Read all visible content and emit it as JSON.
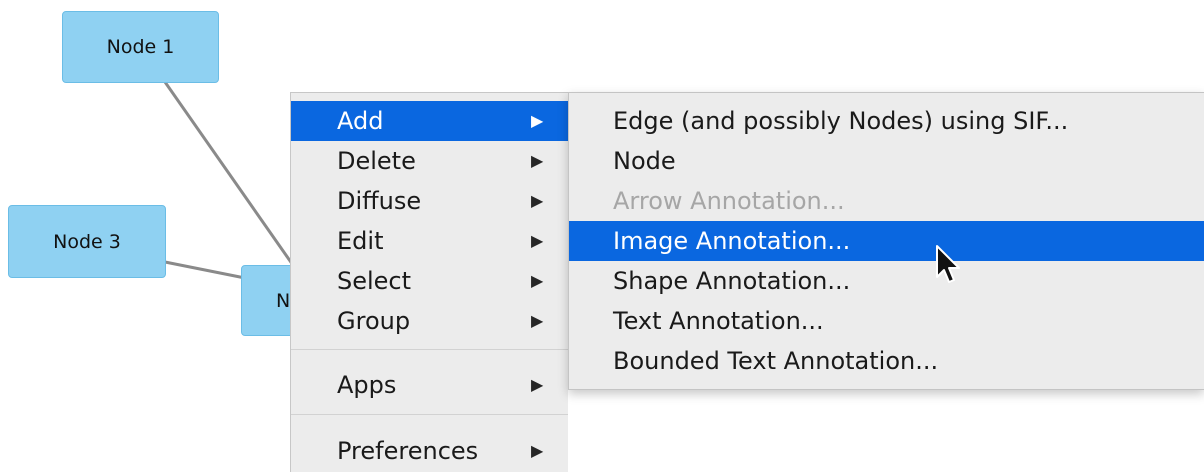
{
  "canvas": {
    "nodes": [
      {
        "label": "Node 1"
      },
      {
        "label": "N"
      },
      {
        "label": "Node 3"
      }
    ]
  },
  "context_menu": {
    "items": [
      {
        "label": "Add",
        "arrow": "▶"
      },
      {
        "label": "Delete",
        "arrow": "▶"
      },
      {
        "label": "Diffuse",
        "arrow": "▶"
      },
      {
        "label": "Edit",
        "arrow": "▶"
      },
      {
        "label": "Select",
        "arrow": "▶"
      },
      {
        "label": "Group",
        "arrow": "▶"
      },
      {
        "label": "Apps",
        "arrow": "▶"
      },
      {
        "label": "Preferences",
        "arrow": "▶"
      }
    ],
    "selected_item": "Add"
  },
  "add_submenu": {
    "items": [
      {
        "label": "Edge (and possibly Nodes) using SIF...",
        "enabled": true
      },
      {
        "label": "Node",
        "enabled": true
      },
      {
        "label": "Arrow Annotation...",
        "enabled": false
      },
      {
        "label": "Image Annotation...",
        "enabled": true
      },
      {
        "label": "Shape Annotation...",
        "enabled": true
      },
      {
        "label": "Text Annotation...",
        "enabled": true
      },
      {
        "label": "Bounded Text Annotation...",
        "enabled": true
      }
    ],
    "highlighted_item": "Image Annotation..."
  },
  "cursor": {
    "icon": "arrow-pointer-icon"
  },
  "colors": {
    "node_fill": "#8fd1f2",
    "menu_background": "#ececec",
    "selection_highlight": "#0a67e0",
    "disabled_text": "#a6a6a6"
  }
}
